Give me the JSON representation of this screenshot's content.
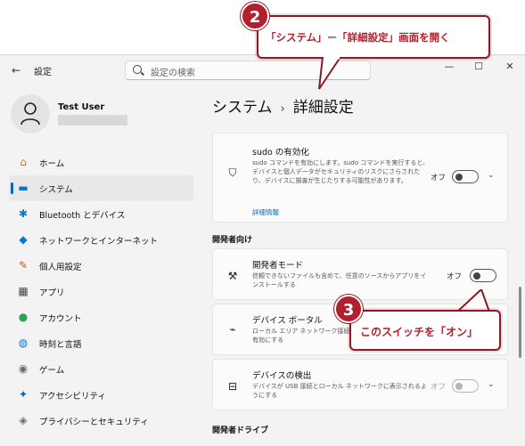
{
  "window": {
    "app_title": "設定",
    "back_glyph": "←",
    "minimize_glyph": "—",
    "maximize_glyph": "☐",
    "close_glyph": "✕"
  },
  "search": {
    "placeholder": "設定の検索"
  },
  "user": {
    "name": "Test User"
  },
  "sidebar": {
    "items": [
      {
        "label": "ホーム",
        "icon": "home-icon",
        "glyph": "⌂",
        "color": "#d47500"
      },
      {
        "label": "システム",
        "icon": "monitor-icon",
        "glyph": "▬",
        "color": "#0078d4",
        "active": true
      },
      {
        "label": "Bluetooth とデバイス",
        "icon": "bluetooth-icon",
        "glyph": "✱",
        "color": "#0078d4"
      },
      {
        "label": "ネットワークとインターネット",
        "icon": "wifi-icon",
        "glyph": "◆",
        "color": "#0078d4"
      },
      {
        "label": "個人用設定",
        "icon": "brush-icon",
        "glyph": "✎",
        "color": "#c25a17"
      },
      {
        "label": "アプリ",
        "icon": "apps-icon",
        "glyph": "▦",
        "color": "#444444"
      },
      {
        "label": "アカウント",
        "icon": "person-icon",
        "glyph": "●",
        "color": "#2ca15a"
      },
      {
        "label": "時刻と言語",
        "icon": "globe-clock-icon",
        "glyph": "◍",
        "color": "#0078d4"
      },
      {
        "label": "ゲーム",
        "icon": "gamepad-icon",
        "glyph": "◉",
        "color": "#6b6b6b"
      },
      {
        "label": "アクセシビリティ",
        "icon": "accessibility-icon",
        "glyph": "✦",
        "color": "#0067c0"
      },
      {
        "label": "プライバシーとセキュリティ",
        "icon": "shield-icon",
        "glyph": "◈",
        "color": "#6b6b6b"
      }
    ]
  },
  "breadcrumb": {
    "parent": "システム",
    "separator": "›",
    "current": "詳細設定"
  },
  "sudo": {
    "title": "sudo の有効化",
    "description": "sudo コマンドを有効にします。sudo コマンドを実行すると、デバイスと個人データがセキュリティのリスクにさらされたり、デバイスに損害が生じたりする可能性があります。",
    "link": "詳細情報",
    "toggle_label": "オフ",
    "icon": "shield-icon"
  },
  "developer_section": {
    "title": "開発者向け"
  },
  "dev_mode": {
    "title": "開発者モード",
    "description": "信頼できないファイルも含めて、任意のソースからアプリをインストールする",
    "toggle_label": "オフ",
    "icon": "dev-tools-icon"
  },
  "device_portal": {
    "title": "デバイス ポータル",
    "description": "ローカル エリア ネットワーク接続…有効にする",
    "icon": "pulse-icon"
  },
  "device_discovery": {
    "title": "デバイスの検出",
    "description": "デバイスが USB 接続とローカル ネットワークに表示されるようにする",
    "toggle_label": "オフ",
    "icon": "device-discovery-icon"
  },
  "dev_drive_section": {
    "title": "開発者ドライブ"
  },
  "annotations": {
    "step2": {
      "number": "2",
      "text": "「システム」－「詳細設定」画面を開く"
    },
    "step3": {
      "number": "3",
      "text": "このスイッチを「オン」"
    }
  },
  "colors": {
    "accent": "#0067c0",
    "annotation": "#b1202c",
    "annotation_border": "#8b1a22"
  }
}
